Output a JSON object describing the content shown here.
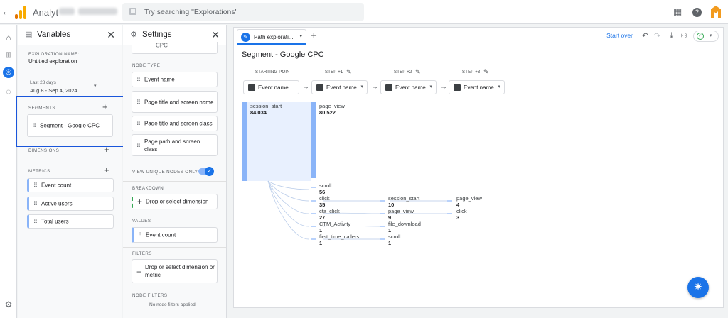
{
  "topbar": {
    "app_name": "Analyt",
    "search_placeholder": "Try searching \"Explorations\"",
    "icons": [
      "back-arrow-icon",
      "apps-grid-icon",
      "help-icon",
      "account-avatar"
    ]
  },
  "colors": {
    "accent": "#1a73e8",
    "node_bar": "#8ab4f8",
    "node_fill": "#e8f0fe",
    "segment_highlight": "#1a56db",
    "logo_orange": "#f9ab00",
    "logo_dark": "#e37400"
  },
  "variables": {
    "title": "Variables",
    "exploration_name_label": "EXPLORATION NAME:",
    "exploration_name": "Untitled exploration",
    "date_range_label": "Last 28 days",
    "date_range": "Aug 8 - Sep 4, 2024",
    "segments_label": "SEGMENTS",
    "segment": "Segment - Google CPC",
    "dimensions_label": "DIMENSIONS",
    "metrics_label": "METRICS",
    "metrics": [
      "Event count",
      "Active users",
      "Total users"
    ]
  },
  "settings": {
    "title": "Settings",
    "top_cutoff": "CPC",
    "node_type_label": "NODE TYPE",
    "node_types": [
      "Event name",
      "Page title and screen name",
      "Page title and screen class",
      "Page path and screen class"
    ],
    "unique_nodes_label": "VIEW UNIQUE NODES ONLY",
    "unique_nodes_on": true,
    "breakdown_label": "BREAKDOWN",
    "breakdown_drop": "Drop or select dimension",
    "values_label": "VALUES",
    "value": "Event count",
    "filters_label": "FILTERS",
    "filters_drop": "Drop or select dimension or metric",
    "node_filters_label": "NODE FILTERS",
    "node_filters_empty": "No node filters applied."
  },
  "main": {
    "tab_name": "Path explorati...",
    "start_over": "Start over",
    "segment_title": "Segment - Google CPC",
    "steps": [
      {
        "label": "STARTING POINT",
        "type": "Event name"
      },
      {
        "label": "STEP +1",
        "type": "Event name"
      },
      {
        "label": "STEP +2",
        "type": "Event name"
      },
      {
        "label": "STEP +3",
        "type": "Event name"
      }
    ],
    "start_node": {
      "name": "session_start",
      "value": "84,034"
    },
    "step1_top": {
      "name": "page_view",
      "value": "80,522"
    },
    "step1_nodes": [
      {
        "name": "scroll",
        "value": "56"
      },
      {
        "name": "click",
        "value": "35"
      },
      {
        "name": "cta_click",
        "value": "27"
      },
      {
        "name": "CTM_Activity",
        "value": "1"
      },
      {
        "name": "first_time_callers",
        "value": "1"
      }
    ],
    "step2_nodes": [
      {
        "name": "session_start",
        "value": "10"
      },
      {
        "name": "page_view",
        "value": "9"
      },
      {
        "name": "file_download",
        "value": "1"
      },
      {
        "name": "scroll",
        "value": "1"
      }
    ],
    "step3_nodes": [
      {
        "name": "page_view",
        "value": "4"
      },
      {
        "name": "click",
        "value": "3"
      }
    ]
  }
}
